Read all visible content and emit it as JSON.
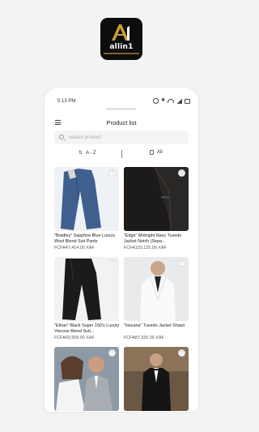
{
  "brand": {
    "name": "allin1",
    "initial": "A1",
    "accent": "#c89b3c",
    "background": "#0d0d0d"
  },
  "status_bar": {
    "time": "5:13 PM",
    "icons": [
      "alarm-icon",
      "bluetooth-icon",
      "wifi-icon",
      "signal-icon",
      "battery-icon"
    ]
  },
  "header": {
    "title": "Product list",
    "menu_icon": "hamburger-menu-icon"
  },
  "search": {
    "placeholder": "Search product",
    "value": ""
  },
  "filters": {
    "sort_label": "A - Z",
    "sort_icon": "sort-icon",
    "category_label": "All",
    "category_icon": "bag-icon"
  },
  "products": [
    {
      "name": "\"Bradley\" Sapphire Blue Luxury Wool Blend Suit Pants",
      "price": "FCFA47,414.00 XAF",
      "image": "blue-suit-pants",
      "favorite_icon": "heart-icon"
    },
    {
      "name": "\"Edge\" Midnight Navy Tuxedo Jacket Notch (Sepa...",
      "price": "FCFA103,125.00 XAF",
      "image": "navy-tuxedo-jacket",
      "favorite_icon": "heart-icon"
    },
    {
      "name": "\"Ethan\" Black Super 150's Luxury Viscose Blend Suit...",
      "price": "FCFA69,909.00 XAF",
      "image": "black-suit-pants",
      "favorite_icon": "heart-icon"
    },
    {
      "name": "\"Havana\" Tuxedo Jacket Shawl",
      "price": "FCFA87,326.00 XAF",
      "image": "white-tuxedo-jacket",
      "favorite_icon": "heart-icon"
    },
    {
      "name": "",
      "price": "",
      "image": "wedding-couple-grey-suit",
      "favorite_icon": "heart-icon"
    },
    {
      "name": "",
      "price": "",
      "image": "groom-black-tuxedo",
      "favorite_icon": "heart-icon"
    }
  ]
}
